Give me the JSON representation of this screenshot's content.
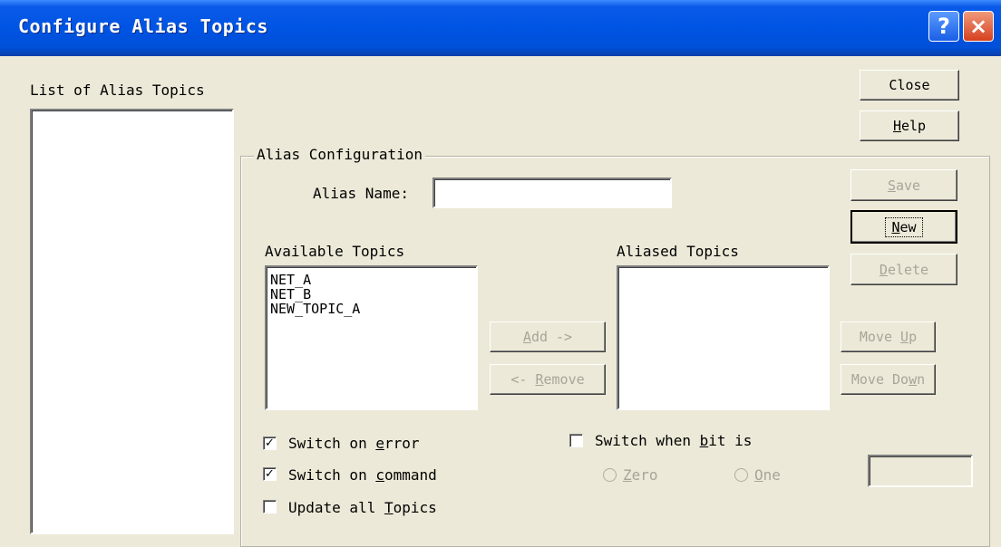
{
  "window": {
    "title": "Configure Alias Topics",
    "help_glyph": "?",
    "close_glyph": "×"
  },
  "alias_list": {
    "label": "List of Alias Topics",
    "items": []
  },
  "buttons": {
    "close": "Close",
    "help": "Help",
    "save": "Save",
    "new": "New",
    "delete": "Delete",
    "add": "Add ->",
    "remove": "<- Remove",
    "move_up": "Move Up",
    "move_down": "Move Down"
  },
  "alias_config": {
    "group_label": "Alias Configuration",
    "alias_name_label": "Alias Name:",
    "alias_name_value": "",
    "available_label": "Available Topics",
    "available_items": [
      "NET_A",
      "NET_B",
      "NEW_TOPIC_A"
    ],
    "aliased_label": "Aliased Topics",
    "aliased_items": []
  },
  "options": {
    "switch_on_error": {
      "label": "Switch on error",
      "checked": true
    },
    "switch_on_command": {
      "label": "Switch on command",
      "checked": true
    },
    "update_all_topics": {
      "label": "Update all Topics",
      "checked": false
    },
    "switch_when_bit": {
      "label": "Switch when bit is",
      "checked": false
    },
    "zero": "Zero",
    "one": "One",
    "bit_value": ""
  },
  "colors": {
    "titlebar": "#0054e3",
    "face": "#ece9d8",
    "disabled_text": "#a8a499",
    "close_red": "#d6401f"
  },
  "icons": {
    "help": "help-icon",
    "close": "close-icon",
    "check": "checkmark"
  }
}
